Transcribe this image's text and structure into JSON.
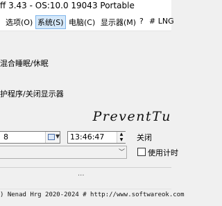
{
  "window": {
    "title": "ff 3.43 - OS:10.0 19043 Portable"
  },
  "menu": {
    "options": "选项(O)",
    "system": "系统(S)",
    "computer": "电脑(C)",
    "monitor": "显示器(M)",
    "help": "?",
    "lang": "# LNG"
  },
  "sleep": {
    "label": "混合睡眠/休眠"
  },
  "screensaver": {
    "label": "护程序/关闭显示器"
  },
  "logo": {
    "text": "PreventTu"
  },
  "schedule": {
    "date_value": "8",
    "time_value": "13:46:47",
    "close_label": "关闭",
    "checkbox_label": "使用计时"
  },
  "status": {
    "ellipsis": "...",
    "copyright": ") Nenad Hrg 2020-2024 # http://www.softwareok.com"
  }
}
